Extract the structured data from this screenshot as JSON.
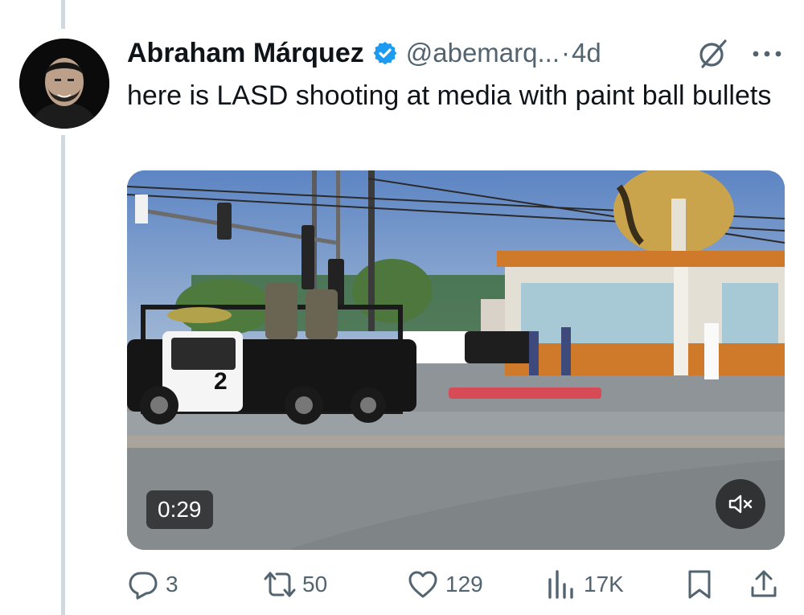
{
  "tweet": {
    "author_name": "Abraham Márquez",
    "handle": "@abemarq...",
    "separator": "·",
    "timestamp": "4d",
    "text": "here is LASD shooting at media with paint ball bullets"
  },
  "media": {
    "duration": "0:29",
    "vehicle_label": "2"
  },
  "actions": {
    "replies": "3",
    "reposts": "50",
    "likes": "129",
    "views": "17K"
  },
  "colors": {
    "verified": "#1d9bf0",
    "secondary_text": "#536471",
    "thread_line": "#cfd9de"
  },
  "icons": [
    "verified-badge-icon",
    "grok-icon",
    "more-icon",
    "mute-icon",
    "reply-icon",
    "repost-icon",
    "like-icon",
    "views-icon",
    "bookmark-icon",
    "share-icon"
  ]
}
